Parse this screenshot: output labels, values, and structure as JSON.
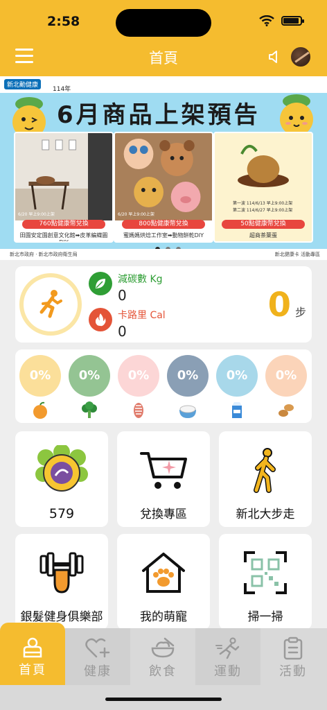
{
  "status_bar": {
    "time": "2:58"
  },
  "header": {
    "title": "首頁"
  },
  "banner": {
    "logo_text": "新北動健康",
    "year_text": "114年",
    "title": "6月商品上架預告",
    "products": [
      {
        "tag": "760點健康幣兌換",
        "subtitle": "田園安定園創意文化館➡皮革編織圖DIY",
        "date": "6/20 早上9:00上架"
      },
      {
        "tag": "800點健康幣兌換",
        "subtitle": "蜜媽媽烘焙工作室➡動物餅乾DIY",
        "date": "6/20 早上9:00上架"
      },
      {
        "tag": "50點健康幣兌換",
        "subtitle": "超商茶葉蛋",
        "lines": [
          "第一波 114/6/13 早上9:00上架",
          "第二波 114/6/27 早上9:00上架"
        ]
      }
    ],
    "foot_left": "新北市政府 · 新北市政府衛生局",
    "foot_right": "新北健康卡 活動專區"
  },
  "stats": {
    "carbon_label": "減碳數 Kg",
    "carbon_value": "0",
    "calorie_label": "卡路里 Cal",
    "calorie_value": "0",
    "steps_value": "0",
    "steps_unit": "步"
  },
  "food": [
    {
      "percent": "0%",
      "color": "#fbdf9a",
      "icon": "fruit-icon"
    },
    {
      "percent": "0%",
      "color": "#94c493",
      "icon": "vegetable-icon"
    },
    {
      "percent": "0%",
      "color": "#fcd6d6",
      "icon": "protein-icon"
    },
    {
      "percent": "0%",
      "color": "#8a9fb5",
      "icon": "grain-icon"
    },
    {
      "percent": "0%",
      "color": "#a8d8ea",
      "icon": "dairy-icon"
    },
    {
      "percent": "0%",
      "color": "#fbd4b9",
      "icon": "nut-icon"
    }
  ],
  "tiles": [
    {
      "label": "579",
      "icon": "health-coin-icon"
    },
    {
      "label": "兌換專區",
      "icon": "cart-icon"
    },
    {
      "label": "新北大步走",
      "icon": "walking-icon"
    },
    {
      "label": "銀髮健身俱樂部",
      "icon": "dumbbell-icon"
    },
    {
      "label": "我的萌寵",
      "icon": "pet-house-icon"
    },
    {
      "label": "掃一掃",
      "icon": "qr-scan-icon"
    }
  ],
  "tabs": [
    {
      "label": "首頁",
      "icon": "home-icon"
    },
    {
      "label": "健康",
      "icon": "heart-plus-icon"
    },
    {
      "label": "飲食",
      "icon": "meal-icon"
    },
    {
      "label": "運動",
      "icon": "run-icon"
    },
    {
      "label": "活動",
      "icon": "clipboard-icon"
    }
  ],
  "colors": {
    "brand_yellow": "#f5bc2f",
    "carbon_green": "#2f9e35",
    "calorie_red": "#e45438",
    "steps_gold": "#f0b21c"
  }
}
